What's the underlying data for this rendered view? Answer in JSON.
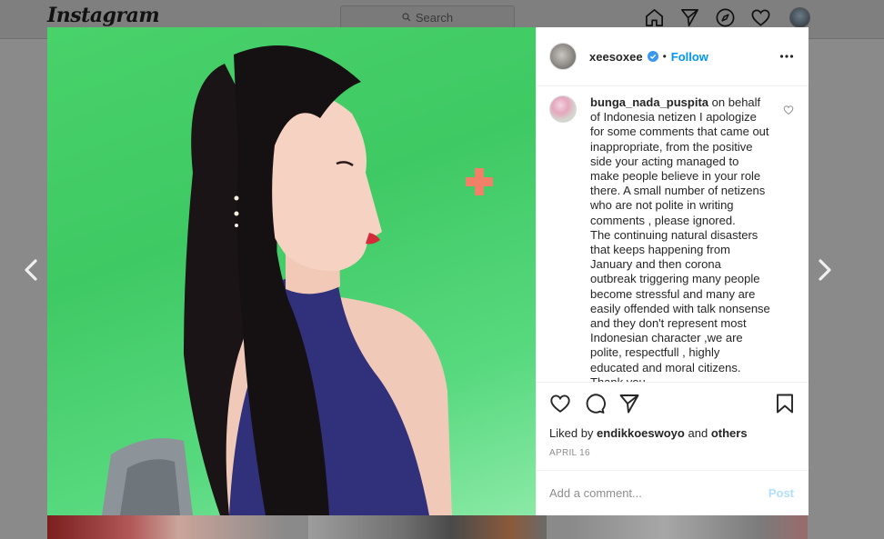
{
  "app": {
    "logo_text": "Instagram"
  },
  "search": {
    "placeholder": "Search"
  },
  "nav": {
    "icons": [
      "home-icon",
      "direct-icon",
      "explore-icon",
      "activity-heart-icon",
      "profile-avatar"
    ]
  },
  "post": {
    "author": {
      "username": "xeesoxee",
      "verified": true,
      "follow_label": "Follow",
      "separator": "•"
    },
    "comment": {
      "username": "bunga_nada_puspita",
      "text_1": "on behalf of Indonesia netizen I apologize for some comments that came out inappropriate, from the positive side your acting managed to make people believe in your role there. A small number of netizens who are not polite in writing comments , please ignored.",
      "text_2": "The continuing natural disasters that keeps happening from January and then corona outbreak triggering many people become stressful and many are easily offended with talk nonsense and they don't represent most Indonesian character ,we are polite, respectfull , highly educated and moral citizens. Thank you."
    },
    "likes": {
      "prefix": "Liked by",
      "user": "endikkoeswoyo",
      "conjunction": "and",
      "others": "others"
    },
    "date": "APRIL 16",
    "add_comment": {
      "placeholder": "Add a comment...",
      "post_label": "Post"
    }
  },
  "colors": {
    "accent": "#0095f6",
    "post_disabled": "#b2dffc",
    "photo_bg": "#49d26a"
  }
}
